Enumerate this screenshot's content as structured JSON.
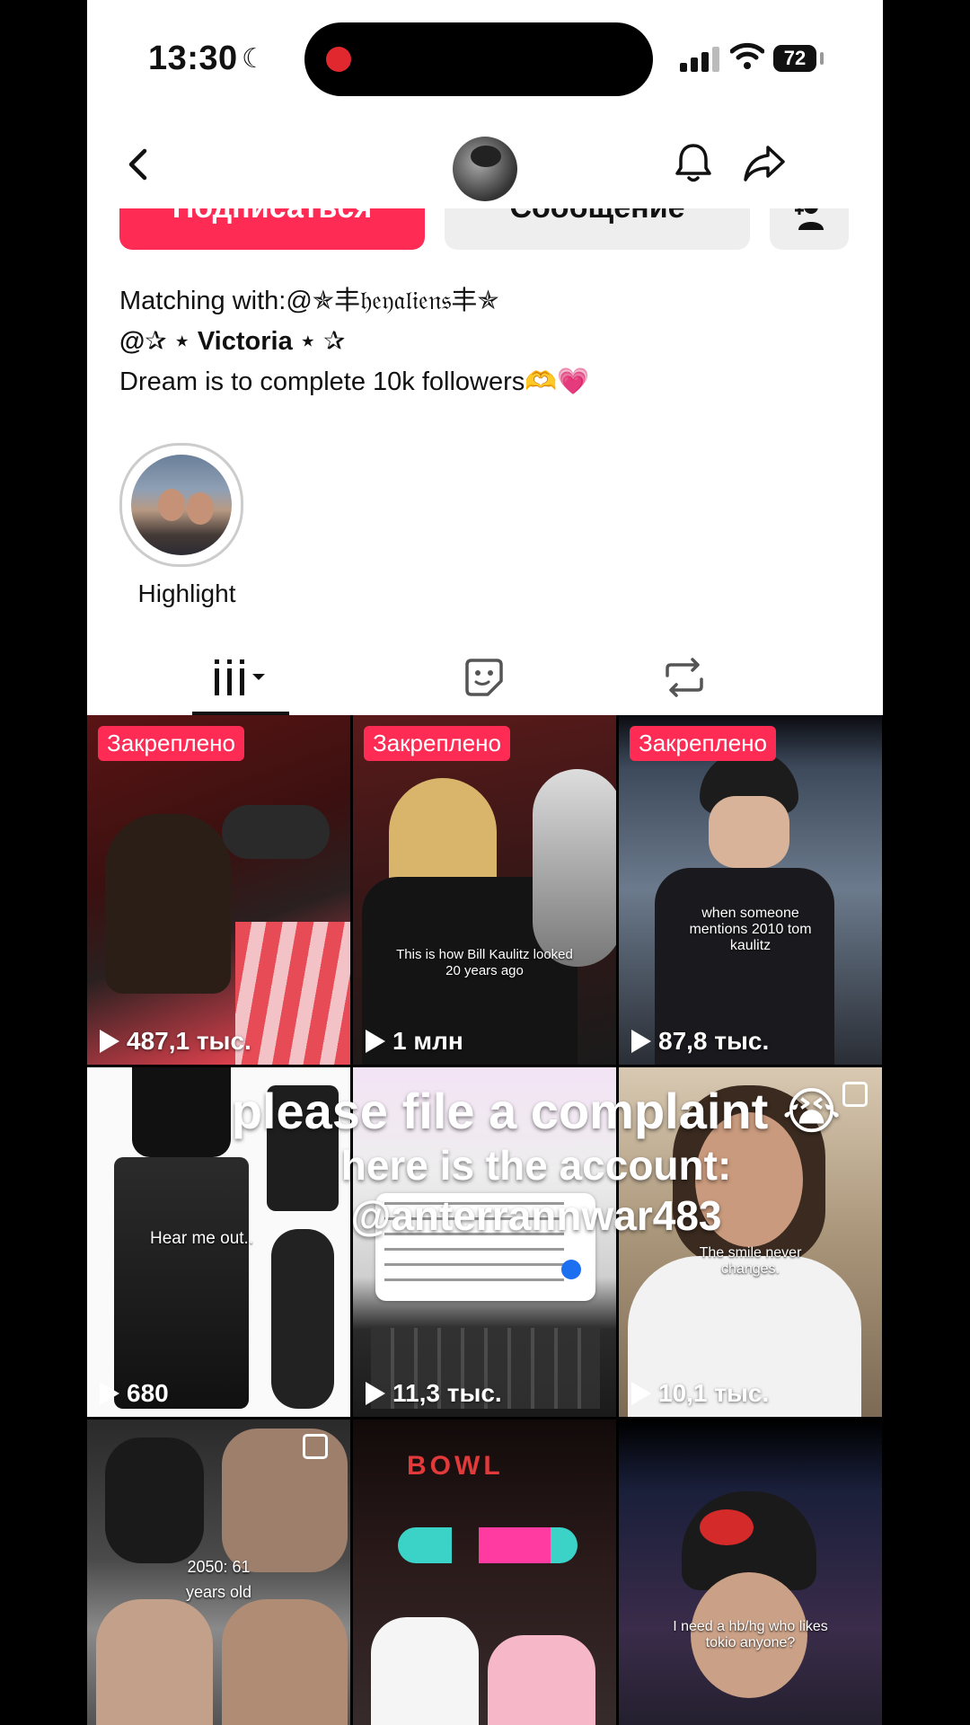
{
  "status": {
    "time": "13:30",
    "battery": "72"
  },
  "profile": {
    "follow_label": "Подписаться",
    "message_label": "Сообщение",
    "bio_lines": [
      "Matching with:@✯丰𝔥𝔢𝔶𝔞𝔩𝔦𝔢𝔫𝔰丰✯",
      "@✰ ⋆ Victoria ⋆ ✰",
      "Dream is to complete 10k followers🫶💗"
    ],
    "highlight_label": "Highlight"
  },
  "videos": [
    {
      "pinned": "Закреплено",
      "views": "487,1 тыс."
    },
    {
      "pinned": "Закреплено",
      "views": "1 млн",
      "caption": "This is how Bill Kaulitz looked 20 years ago"
    },
    {
      "pinned": "Закреплено",
      "views": "87,8 тыс.",
      "caption": "when someone mentions 2010 tom kaulitz"
    },
    {
      "views": "680",
      "caption": "Hear me out.."
    },
    {
      "views": "11,3 тыс."
    },
    {
      "views": "10,1 тыс.",
      "caption": "The smile never changes."
    },
    {
      "caption": "2050: 61 years old"
    },
    {
      "caption": "BOWL"
    },
    {
      "caption": "I need a hb/hg who likes tokio anyone?"
    }
  ],
  "overlay_text": {
    "line1": "please file a complaint 😭",
    "line2": "here is the account:",
    "line3": "@anterrannwar483"
  }
}
